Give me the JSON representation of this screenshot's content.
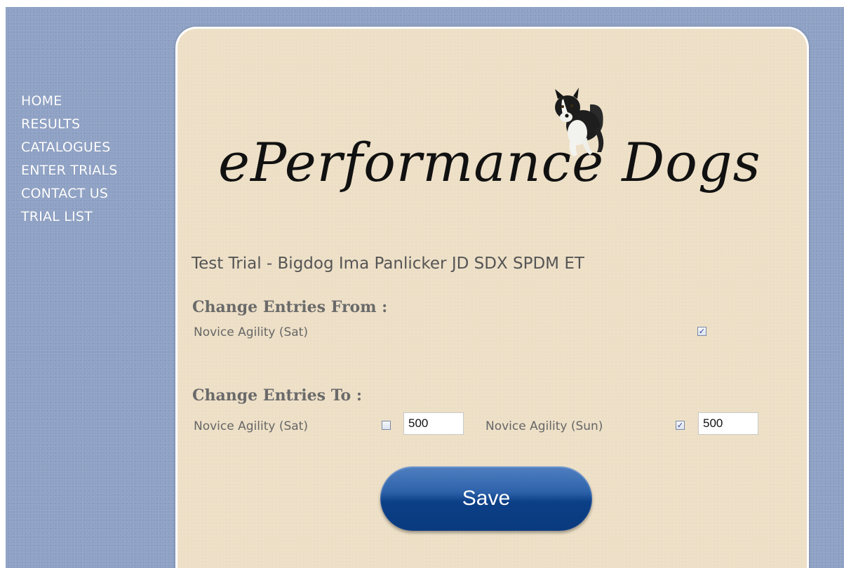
{
  "nav": {
    "items": [
      {
        "label": "HOME"
      },
      {
        "label": "RESULTS"
      },
      {
        "label": "CATALOGUES"
      },
      {
        "label": "ENTER TRIALS"
      },
      {
        "label": "CONTACT US"
      },
      {
        "label": "TRIAL LIST"
      }
    ]
  },
  "logo": {
    "text": "ePerformance Dogs",
    "icon": "border-collie-dog-icon"
  },
  "trial": {
    "title": "Test Trial - Bigdog Ima Panlicker JD SDX SPDM ET"
  },
  "from": {
    "heading": "Change Entries From :",
    "entries": [
      {
        "label": "Novice Agility (Sat)",
        "checked": true
      }
    ]
  },
  "to": {
    "heading": "Change Entries To :",
    "entries": [
      {
        "label": "Novice Agility (Sat)",
        "checked": false,
        "value": "500"
      },
      {
        "label": "Novice Agility (Sun)",
        "checked": true,
        "value": "500"
      }
    ]
  },
  "save": {
    "label": "Save"
  },
  "colors": {
    "page_background": "#8fa2c5",
    "panel_background": "#eddfc6",
    "button_blue": "#0b3f86"
  }
}
